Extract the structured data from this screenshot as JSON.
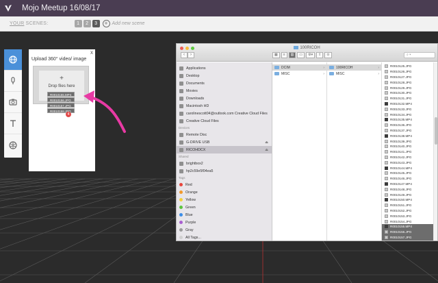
{
  "app": {
    "title": "Mojo Meetup 16/08/17"
  },
  "scenes": {
    "label_prefix": "YOUR",
    "label_suffix": " SCENES:",
    "buttons": [
      "1",
      "2",
      "3"
    ],
    "active_index": 2,
    "add_label": "Add new scene"
  },
  "tools": [
    {
      "name": "globe-tool",
      "icon": "globe-icon",
      "active": true
    },
    {
      "name": "audio-tool",
      "icon": "microphone-icon",
      "active": false
    },
    {
      "name": "photo-tool",
      "icon": "camera-icon",
      "active": false
    },
    {
      "name": "text-tool",
      "icon": "text-icon",
      "active": false
    },
    {
      "name": "web-tool",
      "icon": "web-icon",
      "active": false
    }
  ],
  "upload": {
    "title": "Upload 360° video/ image",
    "close": "x",
    "drop_text": "Drop files here",
    "plus": "+",
    "dragged_files": [
      "R0010155.MP4",
      "R0010156.JPG",
      "R0010157.JPG",
      "R0010158.JPG"
    ],
    "badge": "4"
  },
  "finder": {
    "title": "100RICOH",
    "nav_back": "‹",
    "nav_forward": "›",
    "view_buttons": [
      "▦",
      "≡",
      "▥",
      "▭",
      "⚙▾",
      "⇪",
      "⊙"
    ],
    "search_label": "▾",
    "sidebar": {
      "favorites": [
        {
          "label": "Applications",
          "icon": "applications-icon"
        },
        {
          "label": "Desktop",
          "icon": "desktop-icon"
        },
        {
          "label": "Documents",
          "icon": "documents-icon"
        },
        {
          "label": "Movies",
          "icon": "movies-icon"
        },
        {
          "label": "Downloads",
          "icon": "downloads-icon"
        },
        {
          "label": "Macintosh HD",
          "icon": "disk-icon"
        },
        {
          "label": "carolinescott04@outlook.com Creative Cloud Files",
          "icon": "cloud-icon"
        },
        {
          "label": "Creative Cloud Files",
          "icon": "cloud-icon"
        }
      ],
      "devices_label": "Devices",
      "devices": [
        {
          "label": "Remote Disc",
          "icon": "disc-icon",
          "eject": false
        },
        {
          "label": "G-DRIVE USB",
          "icon": "drive-icon",
          "eject": true
        },
        {
          "label": "RICOHDCX",
          "icon": "drive-icon",
          "eject": true,
          "selected": true
        }
      ],
      "shared_label": "Shared",
      "shared": [
        {
          "label": "brightbox2",
          "icon": "network-icon"
        },
        {
          "label": "hp2c59e5f04ea5",
          "icon": "network-icon"
        }
      ],
      "tags_label": "Tags",
      "tags": [
        {
          "label": "Red",
          "color": "#e8453c"
        },
        {
          "label": "Orange",
          "color": "#f39a2b"
        },
        {
          "label": "Yellow",
          "color": "#f2d03b"
        },
        {
          "label": "Green",
          "color": "#5cc43f"
        },
        {
          "label": "Blue",
          "color": "#3c8ee8"
        },
        {
          "label": "Purple",
          "color": "#a95fd1"
        },
        {
          "label": "Gray",
          "color": "#9a9a9a"
        },
        {
          "label": "All Tags...",
          "color": "#d0d0d0"
        }
      ]
    },
    "column1": [
      {
        "label": "DCIM",
        "selected": true
      },
      {
        "label": "MISC",
        "selected": false
      }
    ],
    "column2": [
      {
        "label": "100RICOH",
        "selected": true
      },
      {
        "label": "MISC",
        "selected": false
      }
    ],
    "files": [
      {
        "label": "R0010125.JPG"
      },
      {
        "label": "R0010126.JPG"
      },
      {
        "label": "R0010127.JPG"
      },
      {
        "label": "R0010128.JPG"
      },
      {
        "label": "R0010129.JPG"
      },
      {
        "label": "R0010130.JPG"
      },
      {
        "label": "R0010131.JPG"
      },
      {
        "label": "R0010132.MP4"
      },
      {
        "label": "R0010133.JPG"
      },
      {
        "label": "R0010134.JPG"
      },
      {
        "label": "R0010135.MP4"
      },
      {
        "label": "R0010136.JPG"
      },
      {
        "label": "R0010137.JPG"
      },
      {
        "label": "R0010138.MP4"
      },
      {
        "label": "R0010139.JPG"
      },
      {
        "label": "R0010140.JPG"
      },
      {
        "label": "R0010141.JPG"
      },
      {
        "label": "R0010142.JPG"
      },
      {
        "label": "R0010143.JPG"
      },
      {
        "label": "R0010144.MP4"
      },
      {
        "label": "R0010145.JPG"
      },
      {
        "label": "R0010146.JPG"
      },
      {
        "label": "R0010147.MP4"
      },
      {
        "label": "R0010148.JPG"
      },
      {
        "label": "R0010149.JPG"
      },
      {
        "label": "R0010150.MP4"
      },
      {
        "label": "R0010151.JPG"
      },
      {
        "label": "R0010152.JPG"
      },
      {
        "label": "R0010153.JPG"
      },
      {
        "label": "R0010154.JPG"
      },
      {
        "label": "R0010155.MP4",
        "selected": true
      },
      {
        "label": "R0010156.JPG",
        "selected": true
      },
      {
        "label": "R0010157.JPG",
        "selected": true
      },
      {
        "label": "R0010158.JPG",
        "selected": true
      },
      {
        "label": "R0010159.MP4"
      }
    ]
  },
  "colors": {
    "topbar": "#4a3d52",
    "accent": "#4a90d9",
    "arrow": "#e83aa4",
    "selection": "#6d6d6d"
  }
}
